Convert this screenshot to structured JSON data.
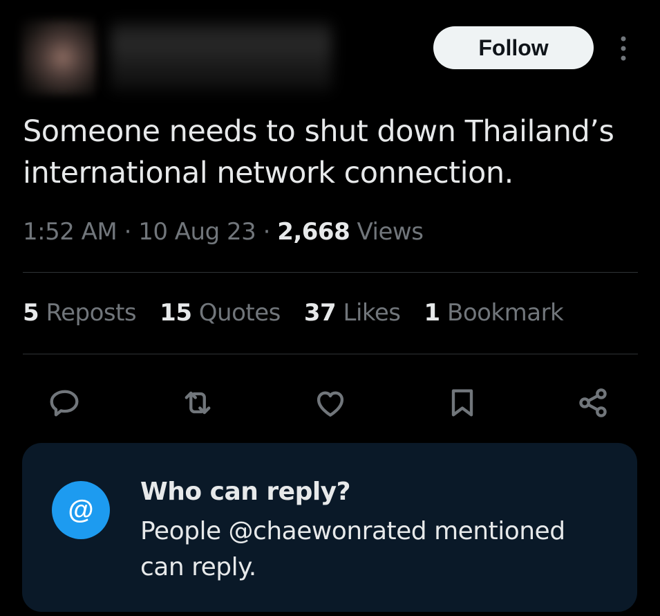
{
  "author": {
    "avatar": "blurred",
    "name": "blurred"
  },
  "follow_label": "Follow",
  "tweet": {
    "text": "Someone needs to shut down Thailand’s international network connection.",
    "time": "1:52 AM",
    "date": "10 Aug 23",
    "separator": "·",
    "views_count": "2,668",
    "views_label": "Views"
  },
  "stats": [
    {
      "count": "5",
      "label": "Reposts"
    },
    {
      "count": "15",
      "label": "Quotes"
    },
    {
      "count": "37",
      "label": "Likes"
    },
    {
      "count": "1",
      "label": "Bookmark"
    }
  ],
  "actions": [
    {
      "icon": "reply-icon"
    },
    {
      "icon": "repost-icon"
    },
    {
      "icon": "like-icon"
    },
    {
      "icon": "bookmark-icon"
    },
    {
      "icon": "share-icon"
    }
  ],
  "reply_settings": {
    "icon": "@",
    "title": "Who can reply?",
    "description": "People @chaewonrated mentioned can reply."
  },
  "colors": {
    "background": "#000000",
    "text_primary": "#e7e9ea",
    "text_secondary": "#71767b",
    "accent": "#1d9bf0",
    "card_background": "#0a1928"
  }
}
